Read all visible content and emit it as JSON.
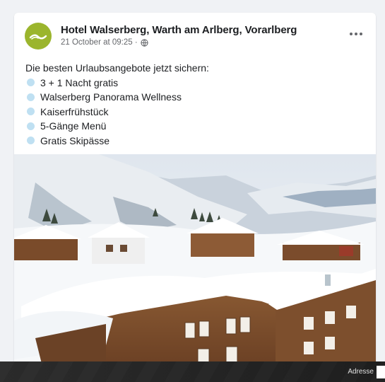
{
  "post": {
    "page_name": "Hotel Walserberg, Warth am Arlberg, Vorarlberg",
    "timestamp": "21 October at 09:25 ·",
    "privacy_icon": "globe-icon",
    "more_icon": "more-options-icon",
    "intro": "Die besten Urlaubsangebote jetzt sichern:",
    "items": [
      {
        "label": "3 + 1 Nacht gratis"
      },
      {
        "label": "Walserberg Panorama Wellness"
      },
      {
        "label": "Kaiserfrühstück"
      },
      {
        "label": "5-Gänge Menü"
      },
      {
        "label": "Gratis Skipässe"
      }
    ],
    "image_icon": "snowy-alpine-village-photo"
  },
  "taskbar": {
    "address_label": "Adresse"
  },
  "colors": {
    "avatar_bg": "#9bb52d",
    "bullet": "#bfe0f2",
    "page_bg": "#f0f2f5"
  }
}
